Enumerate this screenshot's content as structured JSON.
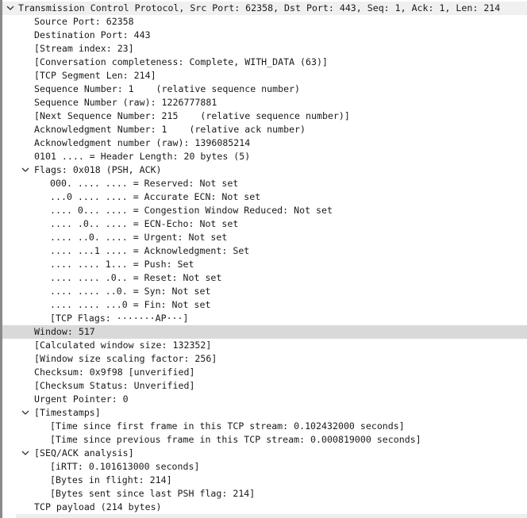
{
  "panel": "packet-details",
  "tree": {
    "root": {
      "label": "Transmission Control Protocol, Src Port: 62358, Dst Port: 443, Seq: 1, Ack: 1, Len: 214",
      "expanded": true
    },
    "fields": {
      "source_port": "Source Port: 62358",
      "destination_port": "Destination Port: 443",
      "stream_index": "[Stream index: 23]",
      "conversation_completeness": "[Conversation completeness: Complete, WITH_DATA (63)]",
      "segment_len": "[TCP Segment Len: 214]",
      "seq_number": "Sequence Number: 1    (relative sequence number)",
      "seq_number_raw": "Sequence Number (raw): 1226777881",
      "next_seq_number": "[Next Sequence Number: 215    (relative sequence number)]",
      "ack_number": "Acknowledgment Number: 1    (relative ack number)",
      "ack_number_raw": "Acknowledgment number (raw): 1396085214",
      "header_length": "0101 .... = Header Length: 20 bytes (5)"
    },
    "flags": {
      "label": "Flags: 0x018 (PSH, ACK)",
      "expanded": true,
      "items": [
        "000. .... .... = Reserved: Not set",
        "...0 .... .... = Accurate ECN: Not set",
        ".... 0... .... = Congestion Window Reduced: Not set",
        ".... .0.. .... = ECN-Echo: Not set",
        ".... ..0. .... = Urgent: Not set",
        ".... ...1 .... = Acknowledgment: Set",
        ".... .... 1... = Push: Set",
        ".... .... .0.. = Reset: Not set",
        ".... .... ..0. = Syn: Not set",
        ".... .... ...0 = Fin: Not set",
        "[TCP Flags: ·······AP···]"
      ]
    },
    "fields2": {
      "window": "Window: 517",
      "calc_window": "[Calculated window size: 132352]",
      "window_scaling": "[Window size scaling factor: 256]",
      "checksum": "Checksum: 0x9f98 [unverified]",
      "checksum_status": "[Checksum Status: Unverified]",
      "urgent_pointer": "Urgent Pointer: 0"
    },
    "timestamps": {
      "label": "[Timestamps]",
      "expanded": true,
      "items": [
        "[Time since first frame in this TCP stream: 0.102432000 seconds]",
        "[Time since previous frame in this TCP stream: 0.000819000 seconds]"
      ]
    },
    "seq_ack": {
      "label": "[SEQ/ACK analysis]",
      "expanded": true,
      "items": [
        "[iRTT: 0.101613000 seconds]",
        "[Bytes in flight: 214]",
        "[Bytes sent since last PSH flag: 214]"
      ]
    },
    "payload": "TCP payload (214 bytes)",
    "selected_row": "Window: 517"
  },
  "colors": {
    "selected_bg": "#d9d9d9",
    "header_bg": "#f0f0f0",
    "text": "#1a1a1a"
  }
}
